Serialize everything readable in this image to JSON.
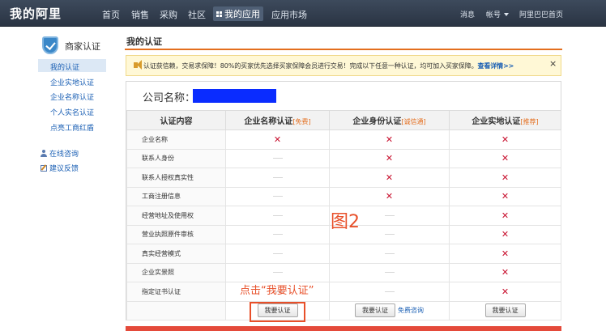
{
  "topbar": {
    "logo": "我的阿里",
    "nav": [
      "首页",
      "销售",
      "采购",
      "社区",
      "我的应用",
      "应用市场"
    ],
    "active_nav": "我的应用",
    "right": {
      "messages": "消息",
      "account": "帐号",
      "home": "阿里巴巴首页"
    }
  },
  "sidebar": {
    "title": "商家认证",
    "items": [
      "我的认证",
      "企业实地认证",
      "企业名称认证",
      "个人实名认证",
      "点亮工商红盾"
    ],
    "active_item": "我的认证",
    "links": [
      "在线咨询",
      "建议反馈"
    ]
  },
  "main": {
    "title": "我的认证",
    "notice": {
      "text": "认证获信赖，交易求保障！80%的买家优先选择买家保障会员进行交易！完成以下任意一种认证，均可加入买家保障。",
      "link": "查看详情>>",
      "close": "×"
    },
    "company_label": "公司名称：",
    "table": {
      "header_label": "认证内容",
      "columns": [
        {
          "name": "企业名称认证",
          "tag": "[免费]"
        },
        {
          "name": "企业身份认证",
          "tag": "[诚信通]"
        },
        {
          "name": "企业实地认证",
          "tag": "[推荐]"
        }
      ],
      "rows": [
        {
          "label": "企业名称",
          "marks": [
            "x",
            "x",
            "x"
          ]
        },
        {
          "label": "联系人身份",
          "marks": [
            "-",
            "x",
            "x"
          ]
        },
        {
          "label": "联系人授权真实性",
          "marks": [
            "-",
            "x",
            "x"
          ]
        },
        {
          "label": "工商注册信息",
          "marks": [
            "-",
            "x",
            "x"
          ]
        },
        {
          "label": "经营地址及使用权",
          "marks": [
            "-",
            "-",
            "x"
          ]
        },
        {
          "label": "营业执照原件审核",
          "marks": [
            "-",
            "-",
            "x"
          ]
        },
        {
          "label": "真实经营模式",
          "marks": [
            "-",
            "-",
            "x"
          ]
        },
        {
          "label": "企业实景照",
          "marks": [
            "-",
            "-",
            "x"
          ]
        },
        {
          "label": "指定证书认证",
          "marks": [
            "-",
            "-",
            "x"
          ]
        }
      ],
      "button_label": "我要认证",
      "consult_link": "免费咨询"
    },
    "annotations": {
      "figure": "图2",
      "instruction": "点击“我要认证”"
    }
  },
  "colors": {
    "accent": "#e46e1e",
    "mark": "#c8102e",
    "annotation": "#e8502a",
    "link": "#1a5fb4"
  }
}
